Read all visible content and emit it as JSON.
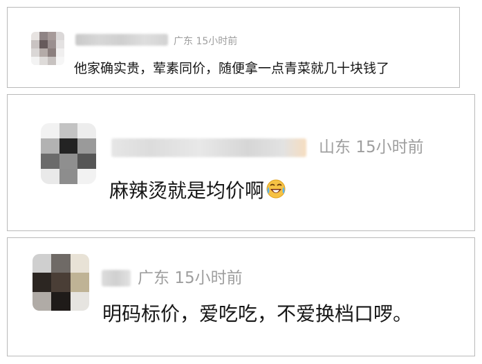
{
  "colors": {
    "border": "#b9b9b9",
    "meta_text": "#9e9e9e",
    "comment_text": "#161616"
  },
  "comments": [
    {
      "location": "广东",
      "time": "15小时前",
      "text": "他家确实贵，荤素同价，随便拿一点青菜就几十块钱了"
    },
    {
      "location": "山东",
      "time": "15小时前",
      "text": "麻辣烫就是均价啊",
      "emoji": "laughing-crying-emoji"
    },
    {
      "location": "广东",
      "time": "15小时前",
      "text": "明码标价，爱吃吃，不爱换档口啰。"
    }
  ]
}
